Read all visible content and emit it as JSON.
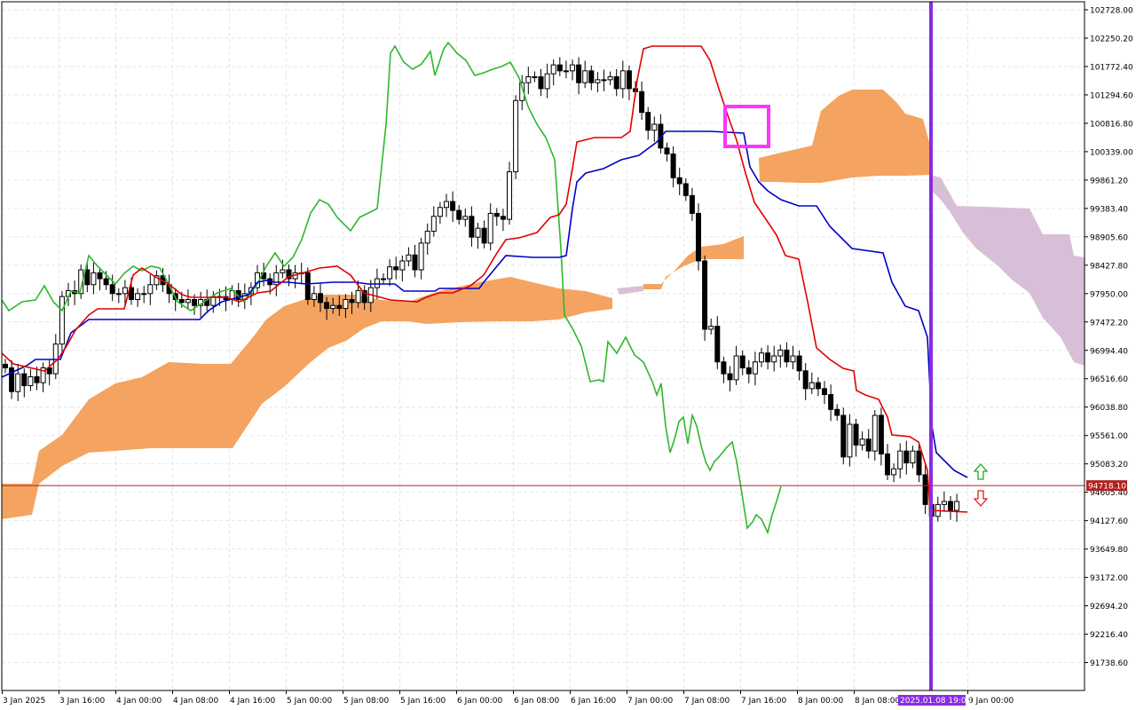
{
  "chart_data": {
    "type": "candlestick",
    "y_ticks": [
      "102728.00",
      "102250.20",
      "101772.40",
      "101294.60",
      "100816.80",
      "100339.00",
      "99861.20",
      "99383.40",
      "98905.60",
      "98427.80",
      "97950.00",
      "97472.20",
      "96994.40",
      "96516.60",
      "96038.80",
      "95561.00",
      "95083.20",
      "94605.40",
      "94127.60",
      "93649.80",
      "93172.00",
      "92694.20",
      "92216.40",
      "91738.60"
    ],
    "x_ticks": [
      "3 Jan 2025",
      "3 Jan 16:00",
      "4 Jan 00:00",
      "4 Jan 08:00",
      "4 Jan 16:00",
      "5 Jan 00:00",
      "5 Jan 08:00",
      "5 Jan 16:00",
      "6 Jan 00:00",
      "6 Jan 08:00",
      "6 Jan 16:00",
      "7 Jan 00:00",
      "7 Jan 08:00",
      "7 Jan 16:00",
      "8 Jan 00:00",
      "8 Jan 08:00",
      "9 Jan 00:00"
    ],
    "ylim": [
      91500,
      102850
    ],
    "grid": true,
    "current_price": "94718.10",
    "cursor_time_label": "2025.01.08 19:00",
    "series": {
      "close": [
        96700,
        96300,
        96600,
        96400,
        96550,
        96450,
        96700,
        96600,
        97100,
        97900,
        98000,
        97950,
        98350,
        98100,
        98300,
        98200,
        98100,
        97950,
        97950,
        98050,
        97850,
        97950,
        97950,
        98100,
        98250,
        98100,
        97950,
        97850,
        97800,
        97850,
        97750,
        97850,
        97750,
        97900,
        97900,
        97850,
        98000,
        97850,
        97950,
        98050,
        98300,
        98200,
        98100,
        98300,
        98350,
        98200,
        98300,
        98300,
        97850,
        97950,
        97800,
        97700,
        97750,
        97700,
        97850,
        97800,
        98000,
        97800,
        98050,
        98200,
        98200,
        98400,
        98350,
        98500,
        98600,
        98350,
        98800,
        99000,
        99250,
        99400,
        99500,
        99350,
        99200,
        99250,
        98900,
        99050,
        98800,
        99300,
        99250,
        99200,
        100000,
        101200,
        101500,
        101600,
        101600,
        101400,
        101650,
        101800,
        101700,
        101700,
        101800,
        101500,
        101700,
        101500,
        101550,
        101550,
        101600,
        101400,
        101700,
        101400,
        101350,
        101000,
        100700,
        100800,
        100400,
        100300,
        99900,
        99800,
        99600,
        99300,
        98500,
        97350,
        97400,
        96800,
        96600,
        96500,
        96900,
        96700,
        96600,
        96800,
        96950,
        96800,
        96900,
        97000,
        96800,
        96900,
        96650,
        96350,
        96450,
        96350,
        96250,
        96000,
        95900,
        95200,
        95750,
        95400,
        95500,
        95300,
        95900,
        95250,
        94900,
        95000,
        95300,
        95100,
        95300,
        94900,
        94400,
        94200,
        94400,
        94450,
        94300,
        94450
      ]
    },
    "annotations": [
      "up-arrow-signal",
      "down-arrow-signal"
    ],
    "colors": {
      "tenkan": "#e00000",
      "kijun": "#0000c8",
      "chikou": "#2eb82e",
      "kumo_bull": "#f4a460",
      "kumo_bear": "#d8bfd8",
      "highlight_box": "#ff33ff",
      "cursor_line": "#8a2be2",
      "price_line": "#b22222",
      "price_tag": "#b22222",
      "time_tag": "#8a2be2",
      "grid": "#e6e6e6"
    }
  }
}
